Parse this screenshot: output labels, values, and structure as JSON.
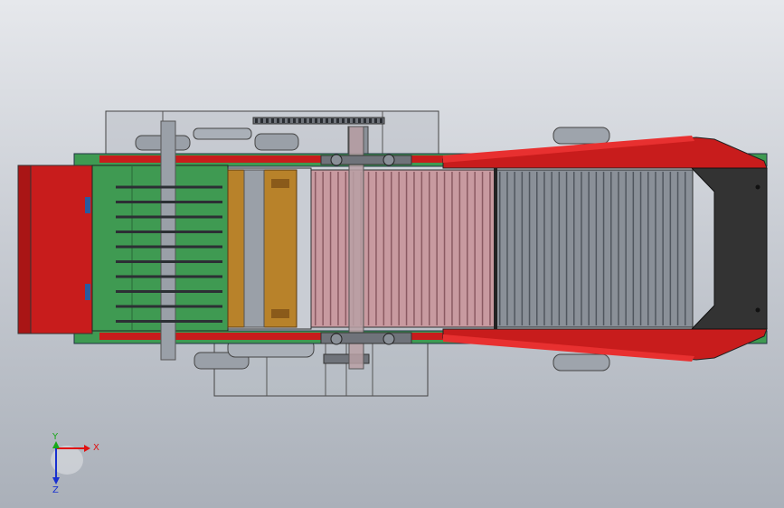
{
  "triad": {
    "x_label": "X",
    "y_label": "Y",
    "z_label": "Z",
    "x_color": "#e01010",
    "y_color": "#18a818",
    "z_color": "#1830d0"
  },
  "colors": {
    "frame_red": "#c81c1c",
    "panel_green": "#3f9a52",
    "roller_orange": "#b8822a",
    "conveyor_pink": "#c89aa0",
    "conveyor_gray": "#8a9098",
    "hopper_dark": "#333333",
    "shaft_gray": "#9aa0a8"
  },
  "components": {
    "spike_rows": 10,
    "pink_slats": 24,
    "gray_slats": 26
  }
}
